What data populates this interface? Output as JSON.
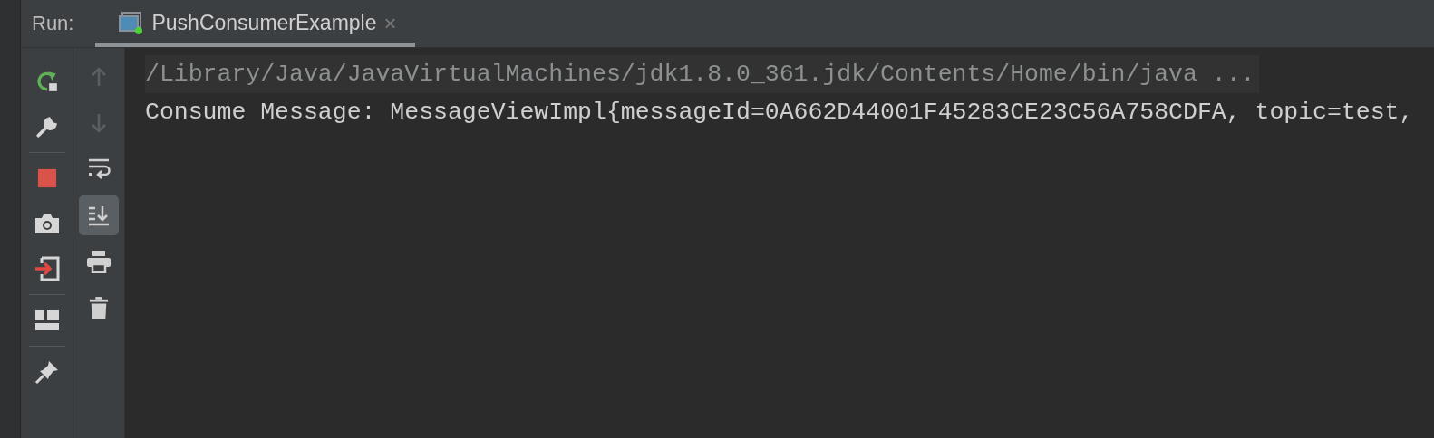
{
  "run_panel": {
    "label": "Run:",
    "tabs": [
      {
        "label": "PushConsumerExample",
        "selected": true,
        "close": "×"
      }
    ]
  },
  "left_toolbar": [
    {
      "kind": "rerun"
    },
    {
      "kind": "wrench"
    },
    {
      "kind": "separator"
    },
    {
      "kind": "stop"
    },
    {
      "kind": "camera"
    },
    {
      "kind": "exit"
    },
    {
      "kind": "separator"
    },
    {
      "kind": "layout"
    },
    {
      "kind": "separator"
    },
    {
      "kind": "pin"
    }
  ],
  "console_toolbar": [
    {
      "kind": "up",
      "disabled": true,
      "active": false
    },
    {
      "kind": "down",
      "disabled": true,
      "active": false
    },
    {
      "kind": "wrap",
      "disabled": false,
      "active": false
    },
    {
      "kind": "scroll-end",
      "disabled": false,
      "active": true
    },
    {
      "kind": "print",
      "disabled": false,
      "active": false
    },
    {
      "kind": "trash",
      "disabled": false,
      "active": false
    }
  ],
  "console_lines": [
    {
      "text": "/Library/Java/JavaVirtualMachines/jdk1.8.0_361.jdk/Contents/Home/bin/java ...",
      "kind": "command"
    },
    {
      "text": "Consume Message: MessageViewImpl{messageId=0A662D44001F45283CE23C56A758CDFA, topic=test,",
      "kind": "output"
    }
  ]
}
